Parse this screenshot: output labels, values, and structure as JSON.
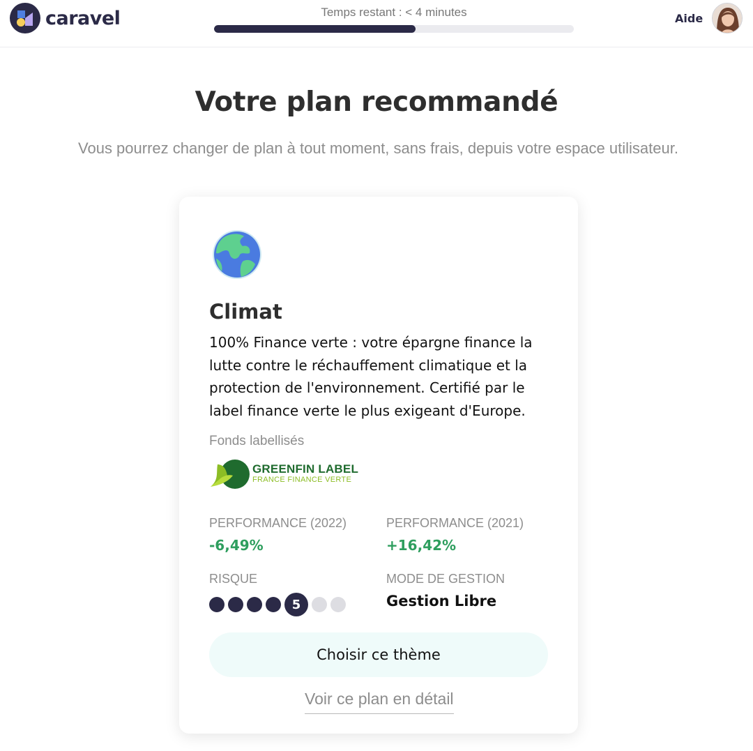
{
  "header": {
    "brand": "caravel",
    "timer_label": "Temps restant : < 4 minutes",
    "progress_fraction": 0.56,
    "help_label": "Aide",
    "colors": {
      "brand_navy": "#2b2a47",
      "logo_yellow": "#f6cf5c",
      "logo_purple": "#b8a7f0"
    }
  },
  "page": {
    "title": "Votre plan recommandé",
    "subtitle": "Vous pourrez changer de plan à tout moment, sans frais, depuis votre espace utilisateur."
  },
  "plan": {
    "icon": "globe-icon",
    "name": "Climat",
    "description": "100% Finance verte : votre épargne finance la lutte contre le réchauffement climatique et la protection de l'environnement. Certifié par le label finance verte le plus exigeant d'Europe.",
    "funds_label": "Fonds labellisés",
    "label_logo": {
      "title": "GREENFIN LABEL",
      "subtitle": "FRANCE FINANCE VERTE"
    },
    "stats": {
      "perf_2022_label": "PERFORMANCE (2022)",
      "perf_2022_value": "-6,49%",
      "perf_2021_label": "PERFORMANCE (2021)",
      "perf_2021_value": "+16,42%",
      "risk_label": "RISQUE",
      "risk_level": "5",
      "risk_max": 7,
      "mode_label": "MODE DE GESTION",
      "mode_value": "Gestion Libre"
    },
    "choose_button": "Choisir ce thème",
    "detail_link": "Voir ce plan en détail",
    "colors": {
      "positive_green": "#2e9e5e",
      "button_bg": "#effbfa"
    }
  }
}
